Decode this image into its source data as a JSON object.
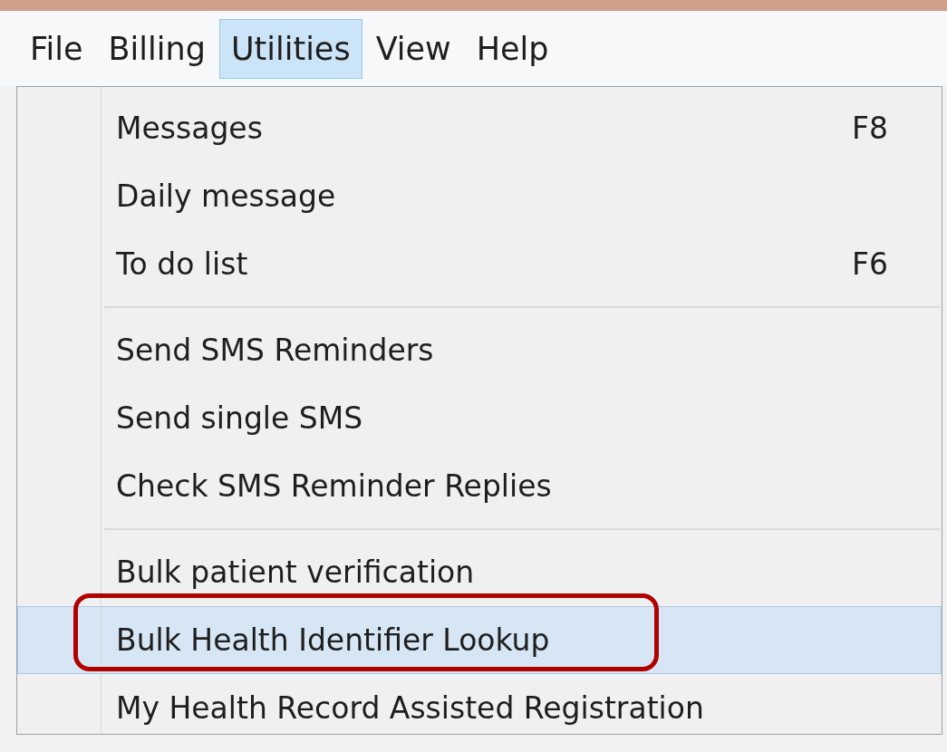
{
  "menubar": [
    {
      "label": "File",
      "selected": false
    },
    {
      "label": "Billing",
      "selected": false
    },
    {
      "label": "Utilities",
      "selected": true
    },
    {
      "label": "View",
      "selected": false
    },
    {
      "label": "Help",
      "selected": false
    }
  ],
  "menu": [
    {
      "kind": "item",
      "label": "Messages",
      "shortcut": "F8",
      "selected": false,
      "circled": false
    },
    {
      "kind": "item",
      "label": "Daily message",
      "selected": false,
      "circled": false
    },
    {
      "kind": "item",
      "label": "To do list",
      "shortcut": "F6",
      "selected": false,
      "circled": false
    },
    {
      "kind": "separator"
    },
    {
      "kind": "item",
      "label": "Send SMS Reminders",
      "selected": false,
      "circled": false
    },
    {
      "kind": "item",
      "label": "Send single SMS",
      "selected": false,
      "circled": false
    },
    {
      "kind": "item",
      "label": "Check SMS Reminder Replies",
      "selected": false,
      "circled": false
    },
    {
      "kind": "separator"
    },
    {
      "kind": "item",
      "label": "Bulk patient verification",
      "selected": false,
      "circled": false
    },
    {
      "kind": "item",
      "label": "Bulk Health Identifier Lookup",
      "selected": true,
      "circled": true
    },
    {
      "kind": "item",
      "label": "My Health Record Assisted Registration",
      "selected": false,
      "circled": false
    }
  ]
}
